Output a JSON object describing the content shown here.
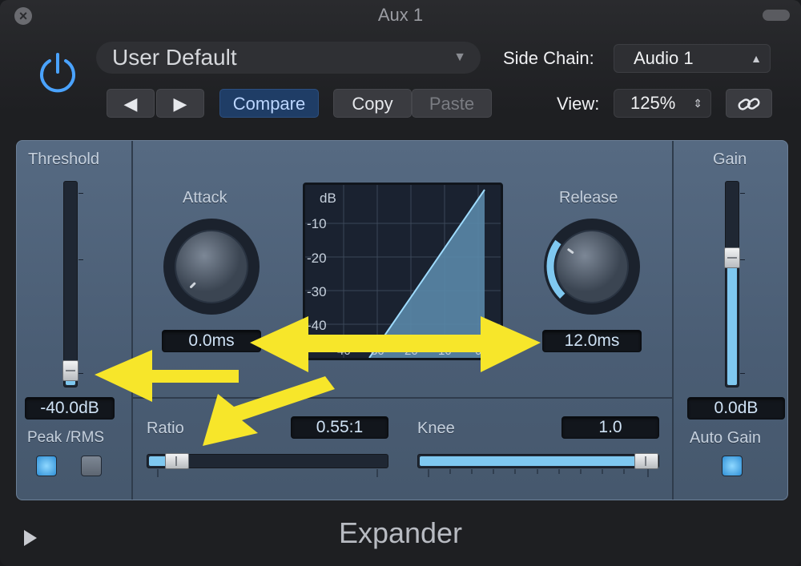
{
  "window": {
    "title": "Aux 1"
  },
  "header": {
    "preset": "User Default",
    "side_chain_label": "Side Chain:",
    "side_chain_value": "Audio 1",
    "view_label": "View:",
    "view_value": "125%",
    "compare_label": "Compare",
    "copy_label": "Copy",
    "paste_label": "Paste",
    "prev_glyph": "◀",
    "next_glyph": "▶"
  },
  "threshold": {
    "label": "Threshold",
    "value": "-40.0dB",
    "fraction": 0.07,
    "peak_rms_label": "Peak /RMS",
    "peak_on": true,
    "rms_on": false
  },
  "attack": {
    "label": "Attack",
    "value": "0.0ms",
    "fraction": 0.0
  },
  "release": {
    "label": "Release",
    "value": "12.0ms",
    "fraction": 0.3
  },
  "graph": {
    "y_labels": [
      "dB",
      "-10",
      "-20",
      "-30",
      "-40"
    ],
    "x_labels": [
      "40",
      "30",
      "20",
      "10",
      "0"
    ]
  },
  "ratio": {
    "label": "Ratio",
    "value": "0.55:1",
    "fraction": 0.08
  },
  "knee": {
    "label": "Knee",
    "value": "1.0",
    "fraction": 1.0
  },
  "gain": {
    "label": "Gain",
    "value": "0.0dB",
    "fraction": 0.63,
    "auto_gain_label": "Auto Gain",
    "auto_gain_on": true
  },
  "footer": {
    "plugin_name": "Expander"
  },
  "colors": {
    "accent": "#7fc8f0",
    "annotation_arrow": "#f7e62a",
    "panel": "#4f6279"
  }
}
